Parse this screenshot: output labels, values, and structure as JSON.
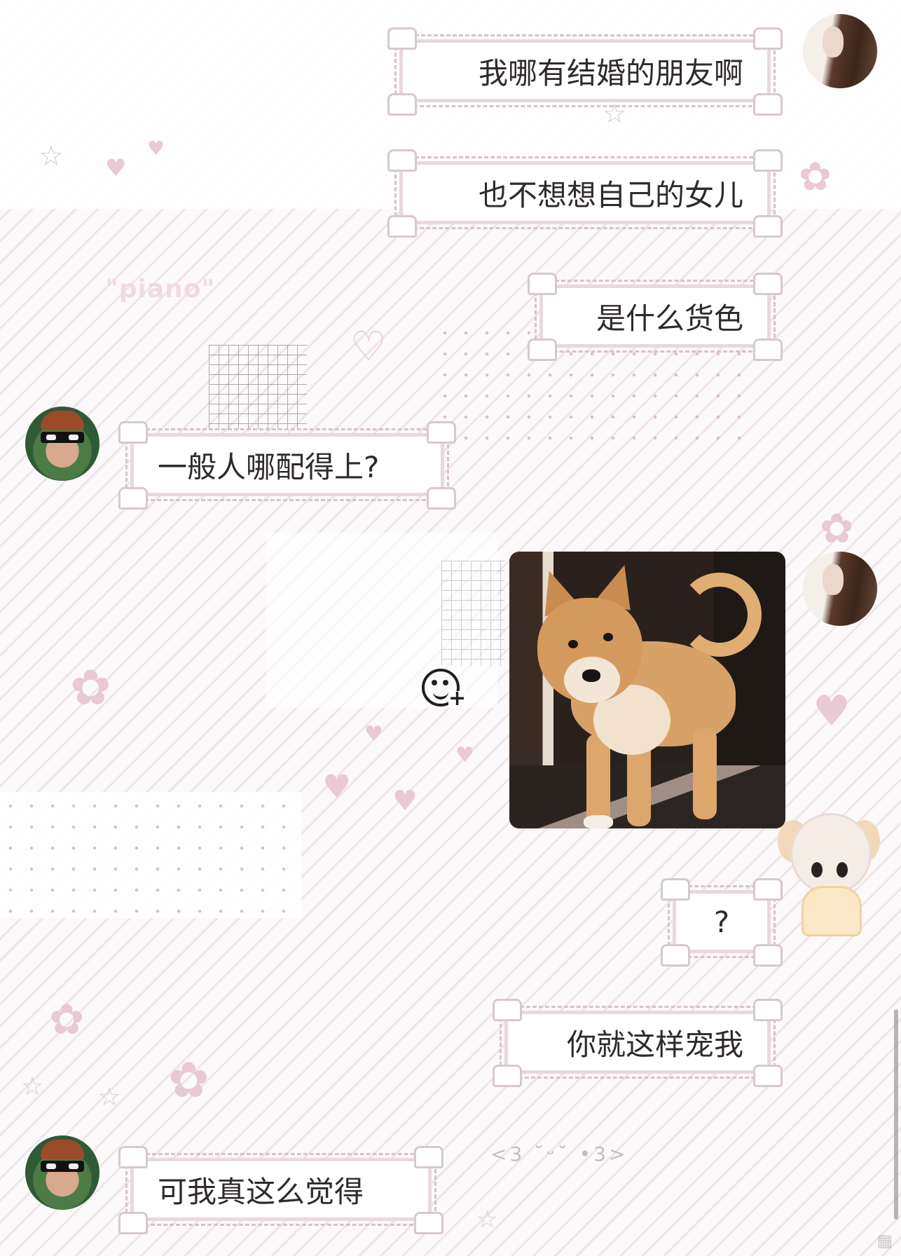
{
  "background": {
    "decor_text": "\"piano\"",
    "kaomoji": "<3 ˘ᵕ˘ •3>",
    "accent_color": "#e7d9de",
    "stripe_color": "#e2d6da"
  },
  "messages": [
    {
      "side": "right",
      "sender": "girl",
      "text": "我哪有结婚的朋友啊"
    },
    {
      "side": "right",
      "sender": "girl",
      "text": "也不想想自己的女儿"
    },
    {
      "side": "right",
      "sender": "girl",
      "text": "是什么货色"
    },
    {
      "side": "left",
      "sender": "boy",
      "text": "一般人哪配得上?"
    },
    {
      "side": "right",
      "sender": "girl",
      "type": "image",
      "image_name": "shiba-inu-photo"
    },
    {
      "side": "right",
      "sender": "girl",
      "text": "?"
    },
    {
      "side": "right",
      "sender": "girl",
      "text": "你就这样宠我"
    },
    {
      "side": "left",
      "sender": "boy",
      "text": "可我真这么觉得"
    }
  ],
  "icons": {
    "add_sticker": "emoji-add-icon"
  }
}
